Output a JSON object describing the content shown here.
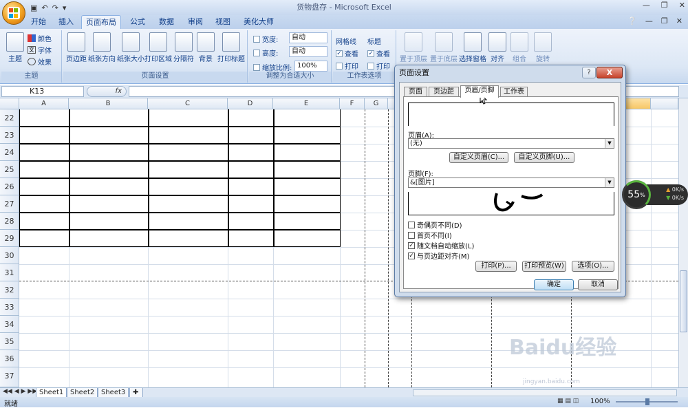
{
  "window": {
    "title": "货物盘存 - Microsoft Excel"
  },
  "tabs": [
    "开始",
    "插入",
    "页面布局",
    "公式",
    "数据",
    "审阅",
    "视图",
    "美化大师"
  ],
  "ribbon": {
    "theme_group": {
      "label": "主题",
      "big": "主题",
      "items": [
        "颜色",
        "字体",
        "效果"
      ]
    },
    "page_setup_group": {
      "label": "页面设置",
      "buttons": [
        "页边距",
        "纸张方向",
        "纸张大小",
        "打印区域",
        "分隔符",
        "背景",
        "打印标题"
      ]
    },
    "scale_group": {
      "label": "调整为合适大小",
      "width_label": "宽度:",
      "width_value": "自动",
      "height_label": "高度:",
      "height_value": "自动",
      "scale_label": "缩放比例:",
      "scale_value": "100%"
    },
    "sheet_options_group": {
      "label": "工作表选项",
      "gridlines": "网格线",
      "headings": "标题",
      "view": "查看",
      "print": "打印"
    },
    "arrange_group": {
      "buttons": [
        "置于顶层",
        "置于底层",
        "选择窗格",
        "对齐",
        "组合",
        "旋转"
      ]
    }
  },
  "formula_bar": {
    "name_box": "K13",
    "fx": "fx"
  },
  "columns": [
    "A",
    "B",
    "C",
    "D",
    "E",
    "F",
    "G"
  ],
  "rows": [
    "22",
    "23",
    "24",
    "25",
    "26",
    "27",
    "28",
    "29",
    "30",
    "31",
    "32",
    "33",
    "34",
    "35",
    "36",
    "37"
  ],
  "sheets": [
    "Sheet1",
    "Sheet2",
    "Sheet3"
  ],
  "status": {
    "ready": "就绪",
    "zoom": "100%"
  },
  "dialog": {
    "title": "页面设置",
    "help": "?",
    "close": "X",
    "tabs": [
      "页面",
      "页边距",
      "页眉/页脚",
      "工作表"
    ],
    "header_label": "页眉(A):",
    "header_value": "(无)",
    "custom_header": "自定义页眉(C)...",
    "custom_footer": "自定义页脚(U)...",
    "footer_label": "页脚(F):",
    "footer_value": "&[图片]",
    "checks": [
      {
        "label": "奇偶页不同(D)",
        "checked": false
      },
      {
        "label": "首页不同(I)",
        "checked": false
      },
      {
        "label": "随文档自动缩放(L)",
        "checked": true
      },
      {
        "label": "与页边距对齐(M)",
        "checked": true
      }
    ],
    "print_btn": "打印(P)...",
    "preview_btn": "打印预览(W)",
    "options_btn": "选项(O)...",
    "ok": "确定",
    "cancel": "取消"
  },
  "net_widget": {
    "percent": "55",
    "unit": "%",
    "up": "0K/s",
    "down": "0K/s"
  },
  "watermark": {
    "main": "Baidu经验",
    "sub": "jingyan.baidu.com"
  }
}
